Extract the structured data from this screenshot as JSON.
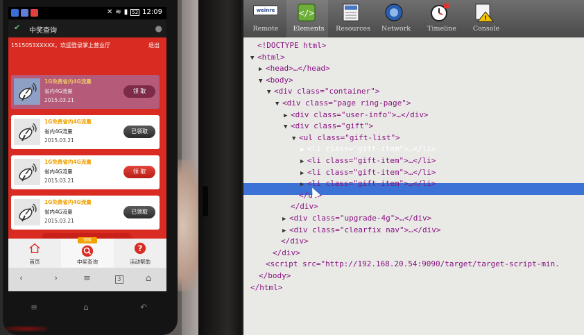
{
  "phone": {
    "status_time": "12:09",
    "status_battery": "52",
    "app_title": "中奖查询",
    "welcome_text": "1515053XXXXX，欢迎登录掌上营业厅",
    "logout_label": "退出",
    "gift_items": [
      {
        "name": "1G免费省内4G流量",
        "desc": "省内4G流量",
        "date": "2015.03.21",
        "button": "领 取",
        "state": "claim",
        "highlighted": true
      },
      {
        "name": "1G免费省内4G流量",
        "desc": "省内4G流量",
        "date": "2015.03.21",
        "button": "已领取",
        "state": "claimed",
        "highlighted": false
      },
      {
        "name": "1G免费省内4G流量",
        "desc": "省内4G流量",
        "date": "2015.03.21",
        "button": "领 取",
        "state": "claim",
        "highlighted": false
      },
      {
        "name": "1G免费省内4G流量",
        "desc": "省内4G流量",
        "date": "2015.03.21",
        "button": "已领取",
        "state": "claimed",
        "highlighted": false
      }
    ],
    "nav": {
      "home_label": "首页",
      "query_label": "中奖查询",
      "query_badge": "领取",
      "help_label": "活动帮助"
    },
    "colors": {
      "page_red": "#d92b22",
      "highlight": "#b65a7a",
      "claim_button": "#c7271e",
      "accent_orange": "#f3a200"
    }
  },
  "devtools": {
    "tools": [
      {
        "label": "Remote",
        "icon": "weinre-logo-icon"
      },
      {
        "label": "Elements",
        "icon": "elements-icon"
      },
      {
        "label": "Resources",
        "icon": "resources-icon"
      },
      {
        "label": "Network",
        "icon": "network-icon"
      },
      {
        "label": "Timeline",
        "icon": "timeline-icon"
      },
      {
        "label": "Console",
        "icon": "console-icon"
      }
    ],
    "weinre_logo_text": "weinre",
    "active_tool": "Elements",
    "dom_lines": [
      {
        "text": "<!DOCTYPE html>"
      },
      {
        "text": "<html>"
      },
      {
        "text": "<head>…</head>"
      },
      {
        "text": "<body>"
      },
      {
        "text": "<div class=\"container\">"
      },
      {
        "text": "<div class=\"page ring-page\">"
      },
      {
        "text": "<div class=\"user-info\">…</div>"
      },
      {
        "text": "<div class=\"gift\">"
      },
      {
        "text": "<ul class=\"gift-list\">"
      },
      {
        "text": "<li class=\"gift-item\">…</li>"
      },
      {
        "text": "<li class=\"gift-item\">…</li>"
      },
      {
        "text": "<li class=\"gift-item\">…</li>"
      },
      {
        "text": "<li class=\"gift-item\">…</li>"
      },
      {
        "text": "</ul>"
      },
      {
        "text": "</div>"
      },
      {
        "text": "<div class=\"upgrade-4g\">…</div>"
      },
      {
        "text": "<div class=\"clearfix nav\">…</div>"
      },
      {
        "text": "</div>"
      },
      {
        "text": "</div>"
      },
      {
        "text": "<script src=\"http://192.168.20.54:9090/target/target-script-min."
      },
      {
        "text": "</body>"
      },
      {
        "text": "</html>"
      }
    ],
    "selected_line": "<li class=\"gift-item\">…</li>"
  }
}
